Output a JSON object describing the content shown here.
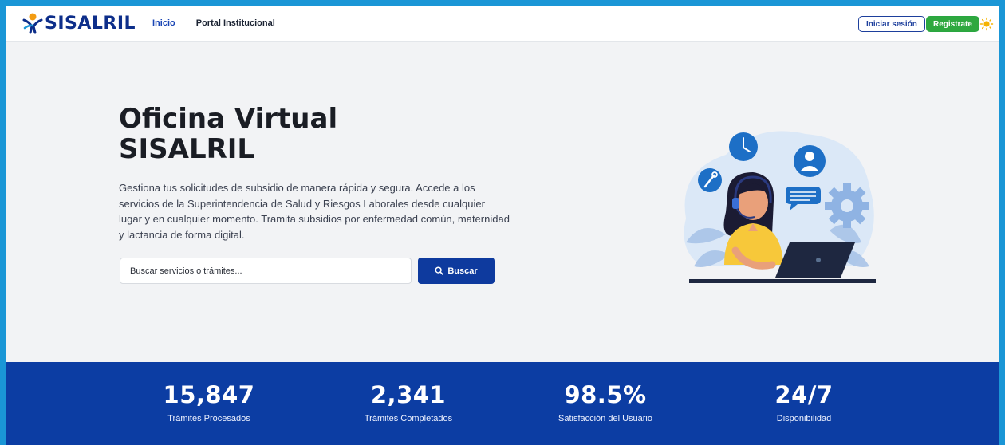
{
  "header": {
    "logo_text": "SISALRIL",
    "nav": [
      {
        "label": "Inicio",
        "active": true
      },
      {
        "label": "Portal Institucional",
        "active": false
      }
    ],
    "login_label": "Iniciar sesión",
    "register_label": "Registrate",
    "theme_icon": "sun-icon"
  },
  "hero": {
    "title_line1": "Oficina Virtual",
    "title_line2": "SISALRIL",
    "description": "Gestiona tus solicitudes de subsidio de manera rápida y segura. Accede a los servicios de la Superintendencia de Salud y Riesgos Laborales desde cualquier lugar y en cualquier momento. Tramita subsidios por enfermedad común, maternidad y lactancia de forma digital.",
    "search_placeholder": "Buscar servicios o trámites...",
    "search_button": "Buscar"
  },
  "stats": [
    {
      "value": "15,847",
      "label": "Trámites Procesados"
    },
    {
      "value": "2,341",
      "label": "Trámites Completados"
    },
    {
      "value": "98.5%",
      "label": "Satisfacción del Usuario"
    },
    {
      "value": "24/7",
      "label": "Disponibilidad"
    }
  ],
  "colors": {
    "primary": "#0c3da3",
    "accent_green": "#2ea83f",
    "page_bg": "#f2f3f5",
    "frame_border": "#1a96d6"
  }
}
